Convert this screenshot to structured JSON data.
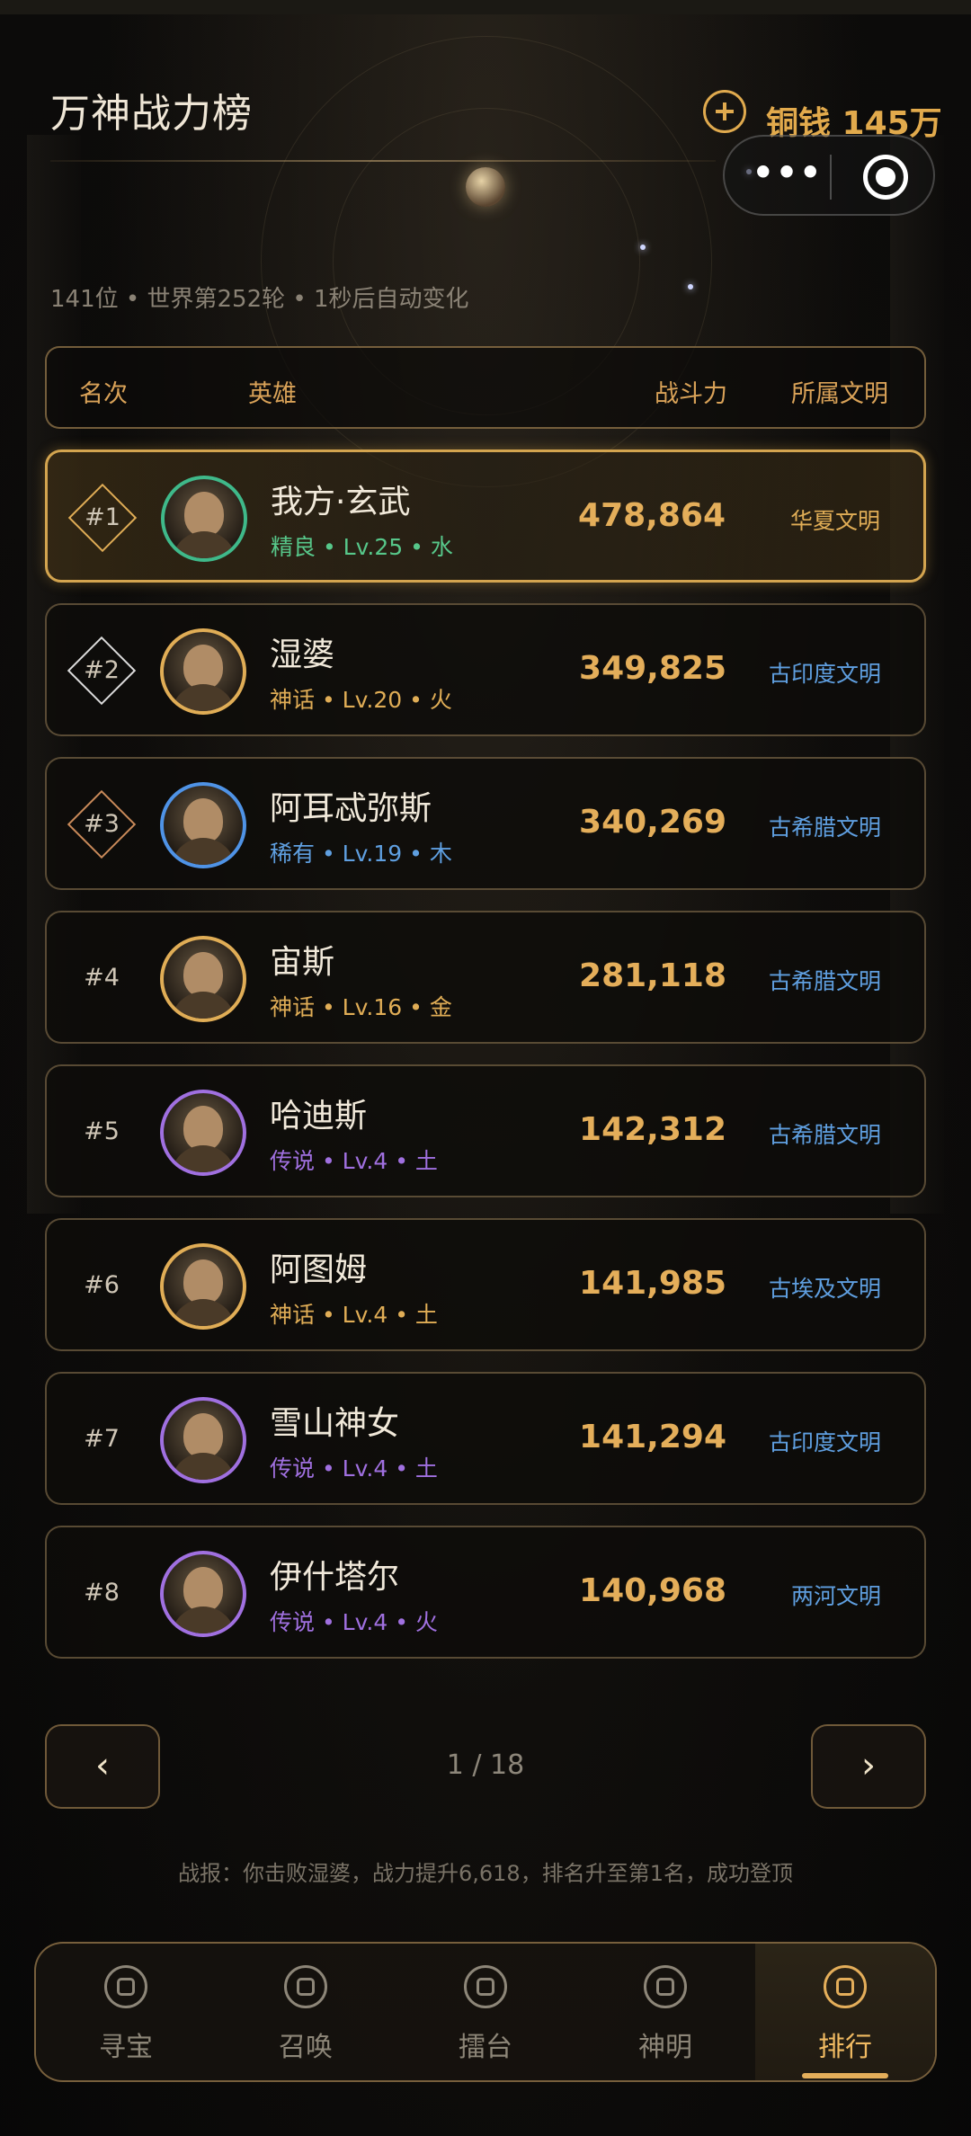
{
  "page": {
    "title": "万神战力榜",
    "currency_text": "铜钱 145万",
    "menu_dots": "•••",
    "status_line": "141位 • 世界第252轮 • 1秒后自动变化"
  },
  "table": {
    "columns": [
      "名次",
      "英雄",
      "战斗力",
      "所属文明"
    ],
    "rows": [
      {
        "rank": "#1",
        "name": "我方·玄武",
        "meta": "精良 • Lv.25 • 水",
        "power": "478,864",
        "civ": "华夏文明",
        "meta_color": "#57c78a",
        "civ_color": "#e0ad56",
        "frame_color": "#3fb98a"
      },
      {
        "rank": "#2",
        "name": "湿婆",
        "meta": "神话 • Lv.20 • 火",
        "power": "349,825",
        "civ": "古印度文明",
        "meta_color": "#e0ad56",
        "civ_color": "#5f9fe0",
        "frame_color": "#e0ad56"
      },
      {
        "rank": "#3",
        "name": "阿耳忒弥斯",
        "meta": "稀有 • Lv.19 • 木",
        "power": "340,269",
        "civ": "古希腊文明",
        "meta_color": "#5f9fe0",
        "civ_color": "#5f9fe0",
        "frame_color": "#4f93e6"
      },
      {
        "rank": "#4",
        "name": "宙斯",
        "meta": "神话 • Lv.16 • 金",
        "power": "281,118",
        "civ": "古希腊文明",
        "meta_color": "#e0ad56",
        "civ_color": "#5f9fe0",
        "frame_color": "#e0ad56"
      },
      {
        "rank": "#5",
        "name": "哈迪斯",
        "meta": "传说 • Lv.4 • 土",
        "power": "142,312",
        "civ": "古希腊文明",
        "meta_color": "#a070e0",
        "civ_color": "#5f9fe0",
        "frame_color": "#a070e0"
      },
      {
        "rank": "#6",
        "name": "阿图姆",
        "meta": "神话 • Lv.4 • 土",
        "power": "141,985",
        "civ": "古埃及文明",
        "meta_color": "#e0ad56",
        "civ_color": "#5f9fe0",
        "frame_color": "#e0ad56"
      },
      {
        "rank": "#7",
        "name": "雪山神女",
        "meta": "传说 • Lv.4 • 土",
        "power": "141,294",
        "civ": "古印度文明",
        "meta_color": "#a070e0",
        "civ_color": "#5f9fe0",
        "frame_color": "#a070e0"
      },
      {
        "rank": "#8",
        "name": "伊什塔尔",
        "meta": "传说 • Lv.4 • 火",
        "power": "140,968",
        "civ": "两河文明",
        "meta_color": "#a070e0",
        "civ_color": "#5f9fe0",
        "frame_color": "#a070e0"
      }
    ]
  },
  "pager": {
    "prev": "‹",
    "next": "›",
    "text": "1 / 18"
  },
  "battle_report": "战报：你击败湿婆，战力提升6,618，排名升至第1名，成功登顶",
  "tabbar": {
    "items": [
      {
        "label": "寻宝",
        "icon": "home-icon"
      },
      {
        "label": "召唤",
        "icon": "summon-icon"
      },
      {
        "label": "擂台",
        "icon": "arena-icon"
      },
      {
        "label": "神明",
        "icon": "deity-icon"
      },
      {
        "label": "排行",
        "icon": "ranking-icon"
      }
    ],
    "active_index": 4
  }
}
